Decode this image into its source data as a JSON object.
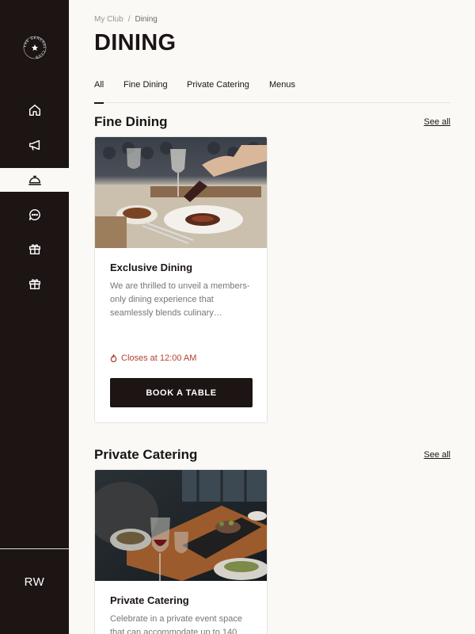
{
  "logo": {
    "text": "THE GENERAL CLUB"
  },
  "sidebar": {
    "items": [
      {
        "name": "home",
        "icon": "home-icon"
      },
      {
        "name": "announcements",
        "icon": "megaphone-icon"
      },
      {
        "name": "dining",
        "icon": "cloche-icon",
        "active": true
      },
      {
        "name": "messages",
        "icon": "chat-bubble-icon"
      },
      {
        "name": "gifts",
        "icon": "gift-icon"
      },
      {
        "name": "rewards",
        "icon": "gift-icon"
      }
    ],
    "avatar_initials": "RW"
  },
  "breadcrumb": {
    "parent": "My Club",
    "separator": "/",
    "current": "Dining"
  },
  "page_title": "DINING",
  "tabs": [
    {
      "label": "All",
      "active": true
    },
    {
      "label": "Fine Dining"
    },
    {
      "label": "Private Catering"
    },
    {
      "label": "Menus"
    }
  ],
  "sections": [
    {
      "title": "Fine Dining",
      "see_all": "See all",
      "card": {
        "title": "Exclusive Dining",
        "description": "We are thrilled to unveil a members-only dining experience that seamlessly blends culinary…",
        "closes": "Closes at 12:00 AM",
        "button": "BOOK A TABLE"
      }
    },
    {
      "title": "Private Catering",
      "see_all": "See all",
      "card": {
        "title": "Private Catering",
        "description": "Celebrate in a private event space that can accommodate up to 140"
      }
    }
  ],
  "colors": {
    "sidebar_bg": "#1d1414",
    "page_bg": "#faf9f6",
    "accent_red": "#b3402f",
    "button_bg": "#1d1414"
  }
}
